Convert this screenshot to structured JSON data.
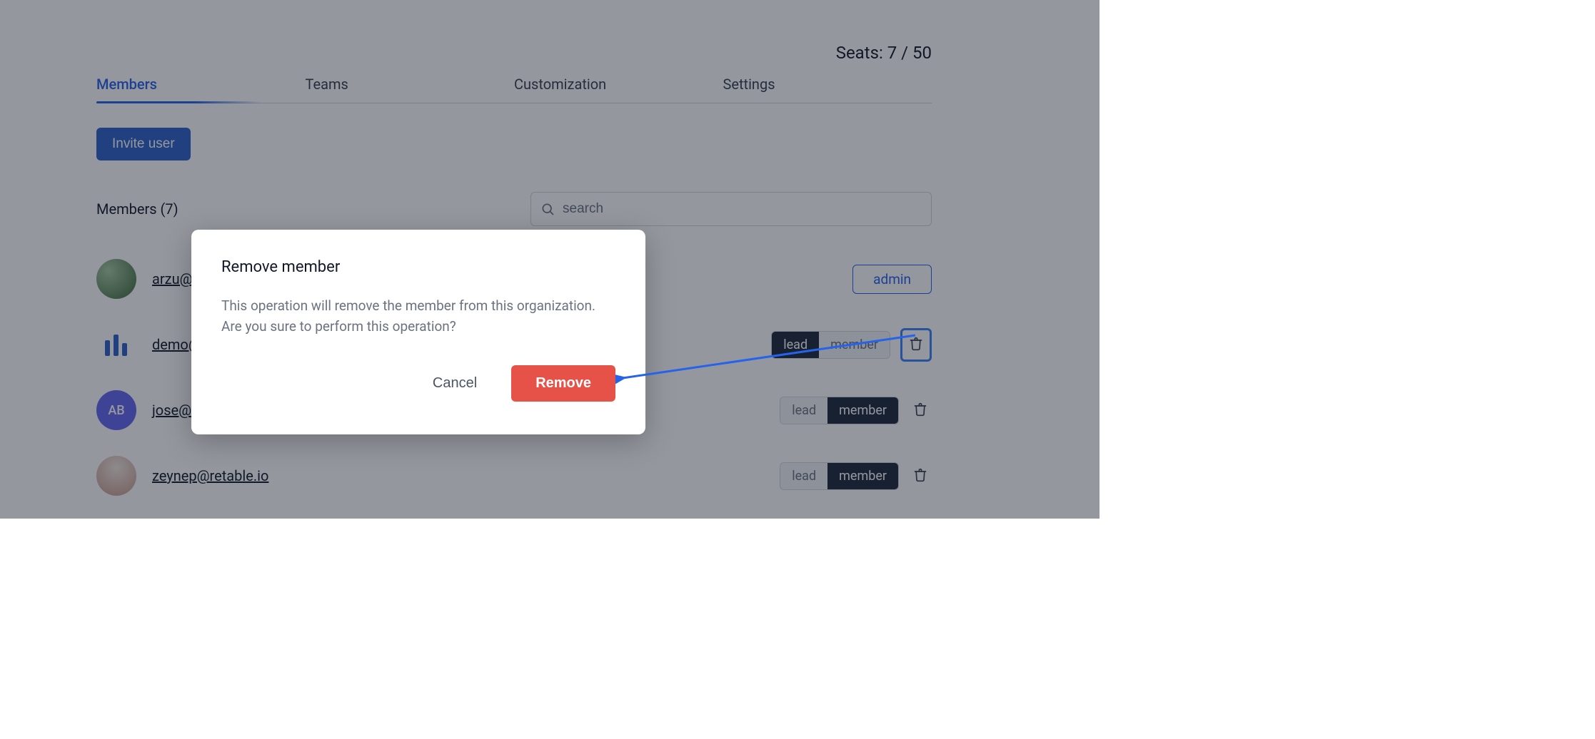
{
  "seats": {
    "label": "Seats: 7 / 50"
  },
  "tabs": [
    {
      "label": "Members",
      "active": true
    },
    {
      "label": "Teams"
    },
    {
      "label": "Customization"
    },
    {
      "label": "Settings"
    }
  ],
  "invite_button": "Invite user",
  "members_heading": "Members (7)",
  "search": {
    "placeholder": "search"
  },
  "members": [
    {
      "email": "arzu@r",
      "avatar_kind": "img1",
      "initials": "",
      "role_badge": "admin",
      "show_toggle": false,
      "show_trash": false
    },
    {
      "email": "demo@",
      "avatar_kind": "logo",
      "initials": "",
      "lead_label": "lead",
      "member_label": "member",
      "active_role": "lead",
      "show_toggle": true,
      "show_trash": true,
      "trash_highlight": true
    },
    {
      "email": "jose@r",
      "avatar_kind": "ab",
      "initials": "AB",
      "lead_label": "lead",
      "member_label": "member",
      "active_role": "member",
      "show_toggle": true,
      "show_trash": true
    },
    {
      "email": "zeynep@retable.io",
      "avatar_kind": "img2",
      "initials": "",
      "lead_label": "lead",
      "member_label": "member",
      "active_role": "member",
      "show_toggle": true,
      "show_trash": true
    }
  ],
  "modal": {
    "title": "Remove member",
    "body": "This operation will remove the member from this organization. Are you sure to perform this operation?",
    "cancel": "Cancel",
    "confirm": "Remove"
  }
}
